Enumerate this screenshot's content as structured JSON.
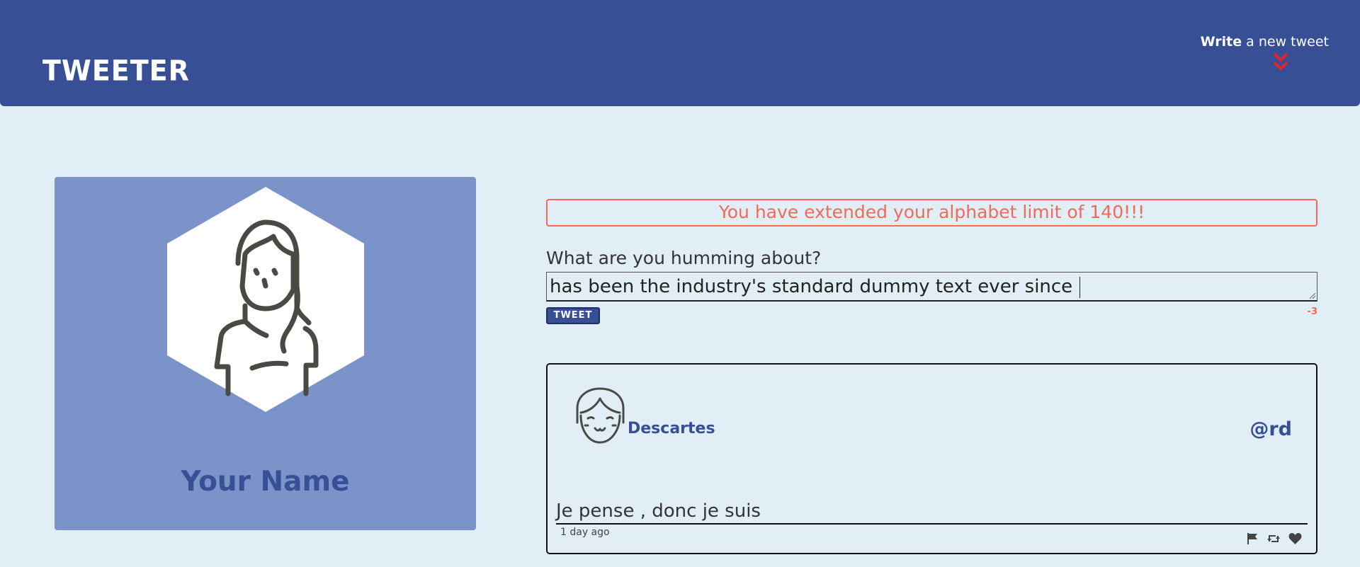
{
  "header": {
    "brand": "TWEETER",
    "compose_link_strong": "Write",
    "compose_link_rest": " a new tweet",
    "compose_arrow_icon": "double-chevron-down-icon",
    "accent_color": "#e0252f",
    "background_color": "#364f95"
  },
  "profile": {
    "avatar_icon": "woman-avatar-icon",
    "name": "Your Name",
    "card_color": "#7b93c9"
  },
  "compose": {
    "error": "You have extended your alphabet limit of 140!!!",
    "label": "What are you humming about?",
    "text": "has been the industry's standard dummy text ever since ",
    "button_label": "TWEET",
    "counter": "-3",
    "error_color": "#f06a5a"
  },
  "tweets": [
    {
      "avatar_icon": "girl-avatar-icon",
      "author": "Descartes",
      "handle": "@rd",
      "content": "Je pense , donc je suis",
      "time": "1 day ago",
      "actions": [
        "flag-icon",
        "retweet-icon",
        "heart-icon"
      ]
    }
  ]
}
